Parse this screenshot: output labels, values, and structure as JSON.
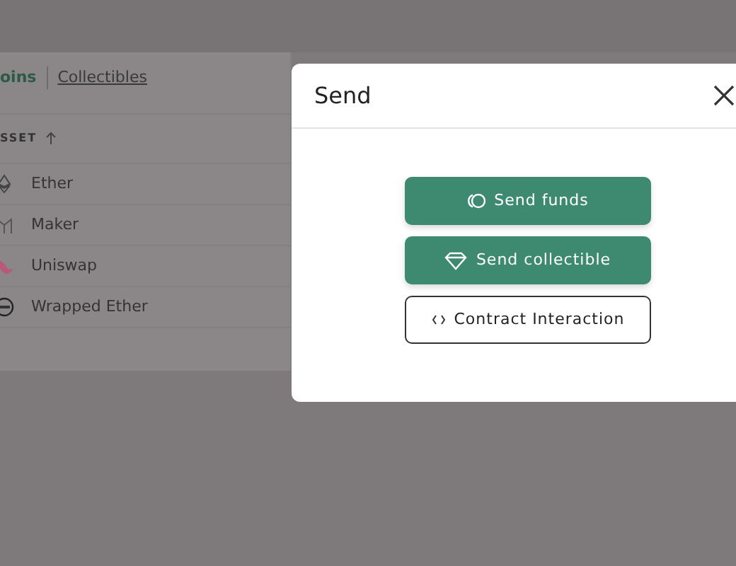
{
  "tabs": [
    {
      "label": "oins",
      "selected": true
    },
    {
      "label": "Collectibles",
      "selected": false
    }
  ],
  "table": {
    "column": "SSET",
    "rows": [
      {
        "name": "Ether"
      },
      {
        "name": "Maker"
      },
      {
        "name": "Uniswap"
      },
      {
        "name": "Wrapped Ether"
      }
    ]
  },
  "modal": {
    "title": "Send",
    "buttons": [
      {
        "label": "Send funds",
        "kind": "filled"
      },
      {
        "label": "Send collectible",
        "kind": "filled"
      },
      {
        "label": "Contract Interaction",
        "kind": "outline"
      }
    ]
  }
}
